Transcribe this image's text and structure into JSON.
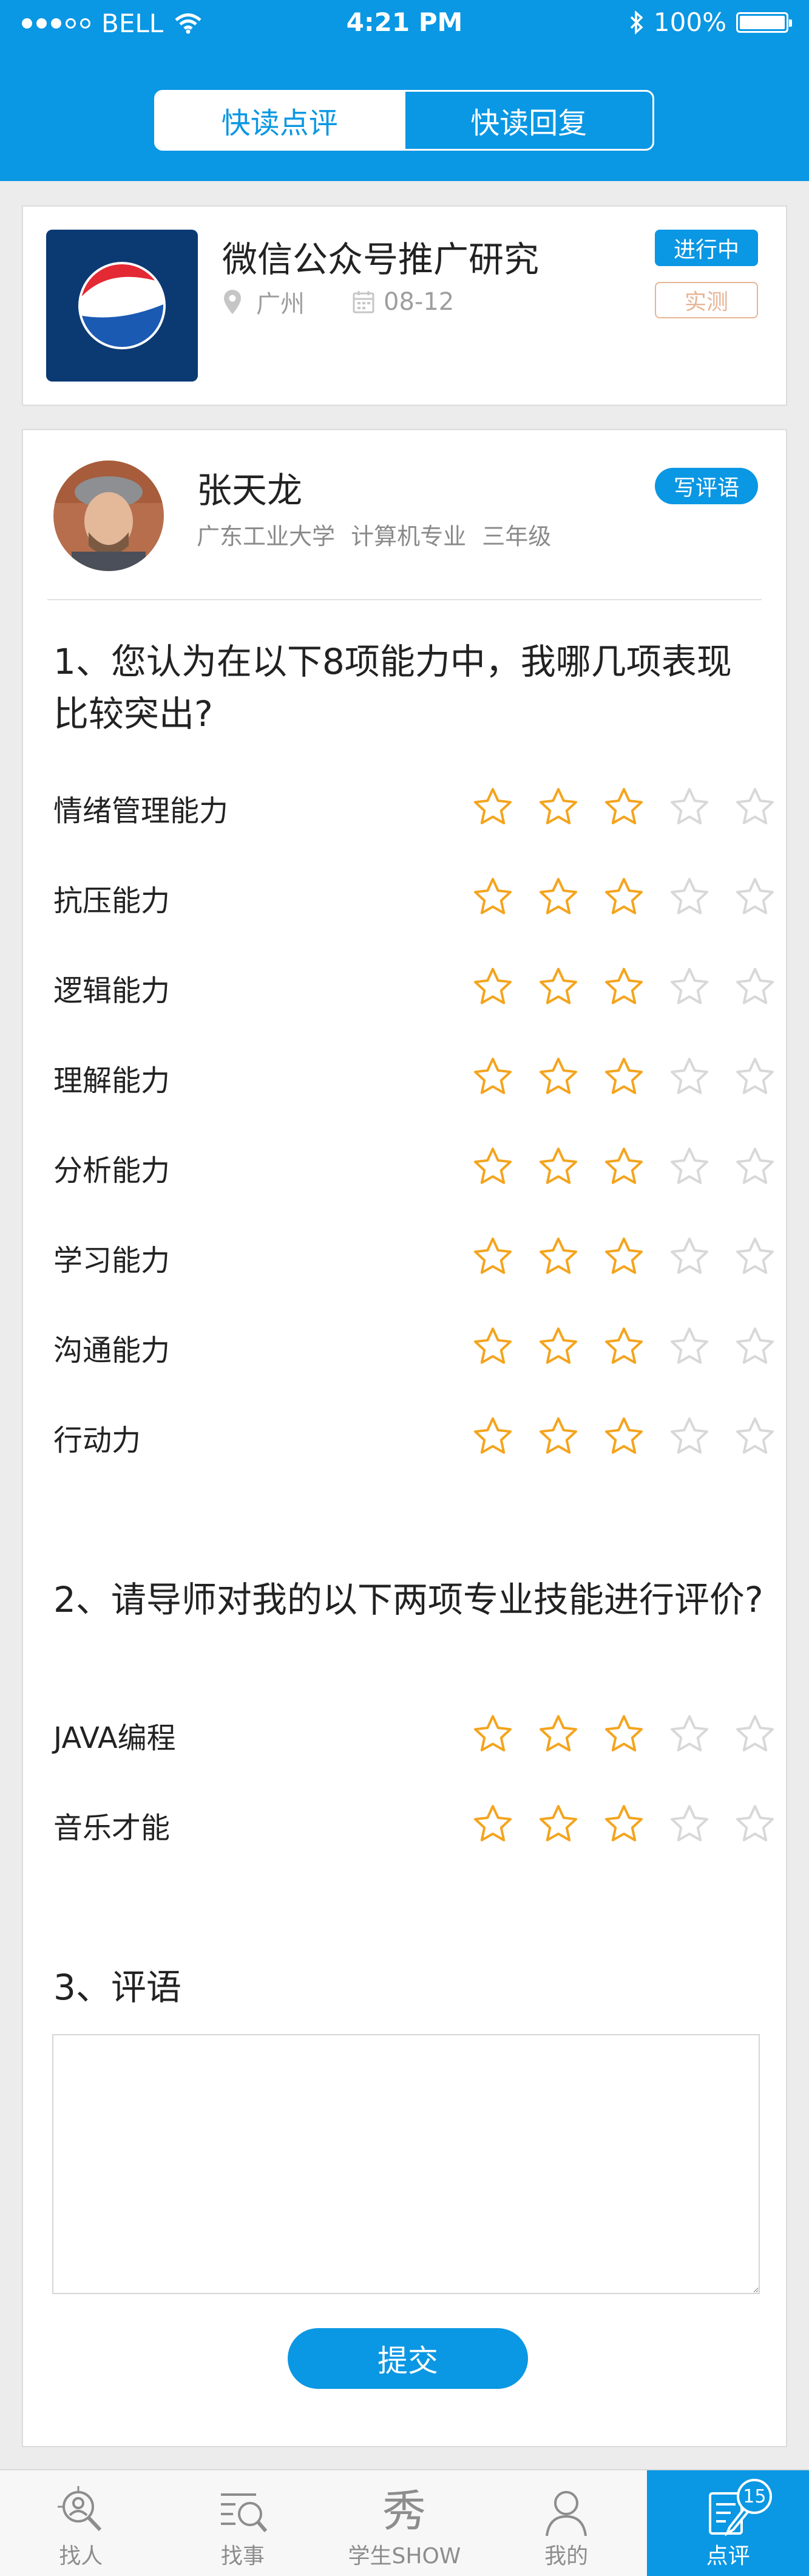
{
  "status": {
    "carrier": "BELL",
    "time": "4:21 PM",
    "battery": "100%"
  },
  "segments": {
    "active": "快读点评",
    "inactive": "快读回复"
  },
  "project": {
    "title": "微信公众号推广研究",
    "city": "广州",
    "date": "08-12",
    "status_tag": "进行中",
    "type_tag": "实测"
  },
  "student": {
    "name": "张天龙",
    "school": "广东工业大学",
    "major": "计算机专业",
    "grade": "三年级",
    "write_label": "写评语"
  },
  "q1": {
    "text": "1、您认为在以下8项能力中，我哪几项表现比较突出?",
    "items": [
      {
        "label": "情绪管理能力",
        "rating": 3
      },
      {
        "label": "抗压能力",
        "rating": 3
      },
      {
        "label": "逻辑能力",
        "rating": 3
      },
      {
        "label": "理解能力",
        "rating": 3
      },
      {
        "label": "分析能力",
        "rating": 3
      },
      {
        "label": "学习能力",
        "rating": 3
      },
      {
        "label": "沟通能力",
        "rating": 3
      },
      {
        "label": "行动力",
        "rating": 3
      }
    ]
  },
  "q2": {
    "text": "2、请导师对我的以下两项专业技能进行评价?",
    "items": [
      {
        "label": "JAVA编程",
        "rating": 3
      },
      {
        "label": "音乐才能",
        "rating": 3
      }
    ]
  },
  "q3": {
    "text": "3、评语",
    "comment_value": ""
  },
  "submit_label": "提交",
  "tabs": [
    {
      "label": "找人",
      "icon": "find-person-icon"
    },
    {
      "label": "找事",
      "icon": "find-task-icon"
    },
    {
      "label": "学生SHOW",
      "icon": "show-icon"
    },
    {
      "label": "我的",
      "icon": "profile-icon"
    },
    {
      "label": "点评",
      "icon": "review-icon",
      "badge": "15"
    }
  ],
  "colors": {
    "primary": "#0a97e3",
    "star_on": "#f4a41d",
    "star_off": "#d8d8d8"
  }
}
